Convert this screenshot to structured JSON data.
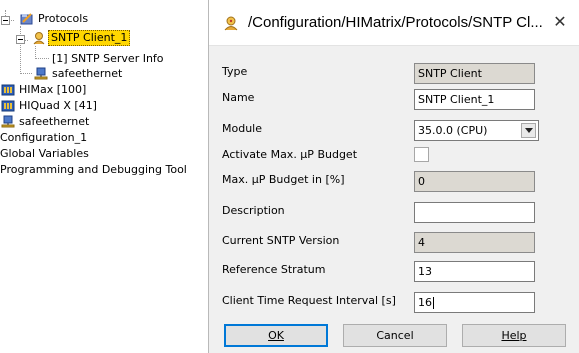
{
  "tree": {
    "items": [
      {
        "label": "Protocols",
        "icon": "protocols-icon"
      },
      {
        "label": "SNTP Client_1",
        "icon": "sntp-client-icon",
        "selected": true
      },
      {
        "label": "[1] SNTP Server Info",
        "icon": ""
      },
      {
        "label": "safeethernet",
        "icon": "network-icon"
      },
      {
        "label": "HIMax [100]",
        "icon": "controller-icon"
      },
      {
        "label": "HIQuad X [41]",
        "icon": "controller-icon"
      },
      {
        "label": "safeethernet",
        "icon": "network-icon"
      },
      {
        "label": "Configuration_1",
        "icon": ""
      },
      {
        "label": "Global Variables",
        "icon": ""
      },
      {
        "label": "Programming and Debugging Tool",
        "icon": ""
      }
    ]
  },
  "dialog": {
    "title": "/Configuration/HIMatrix/Protocols/SNTP Cl...",
    "close_glyph": "✕",
    "fields": {
      "type": {
        "label": "Type",
        "value": "SNTP Client"
      },
      "name": {
        "label": "Name",
        "value": "SNTP Client_1"
      },
      "module": {
        "label": "Module",
        "value": "35.0.0 (CPU)"
      },
      "budget_active": {
        "label": "Activate Max. µP Budget",
        "checked": false
      },
      "budget_pct": {
        "label": "Max. µP Budget in [%]",
        "value": "0"
      },
      "description": {
        "label": "Description",
        "value": ""
      },
      "sntp_version": {
        "label": "Current SNTP Version",
        "value": "4"
      },
      "stratum": {
        "label": "Reference Stratum",
        "value": "13"
      },
      "interval": {
        "label": "Client Time Request Interval [s]",
        "value": "16"
      }
    },
    "buttons": {
      "ok": "OK",
      "cancel": "Cancel",
      "help": "Help"
    }
  }
}
